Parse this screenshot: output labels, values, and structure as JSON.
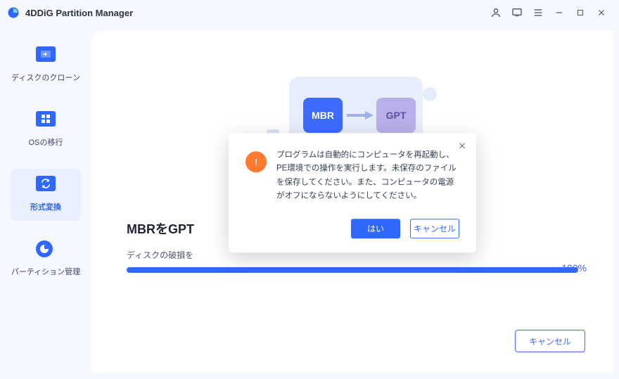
{
  "app": {
    "title": "4DDiG Partition Manager"
  },
  "sidebar": {
    "items": [
      {
        "label": "ディスクのクローン"
      },
      {
        "label": "OSの移行"
      },
      {
        "label": "形式変換"
      },
      {
        "label": "パーティション管理"
      }
    ],
    "active_index": 2
  },
  "main": {
    "heading": "MBRをGPT",
    "subtext": "ディスクの破損を",
    "progress_percent": 100,
    "progress_label": "100%",
    "cancel_button": "キャンセル",
    "illus": {
      "left_badge": "MBR",
      "right_badge": "GPT"
    }
  },
  "dialog": {
    "message": "プログラムは自動的にコンピュータを再起動し、PE環境での操作を実行します。未保存のファイルを保存してください。また、コンピュータの電源がオフにならないようにしてください。",
    "confirm": "はい",
    "cancel": "キャンセル"
  }
}
